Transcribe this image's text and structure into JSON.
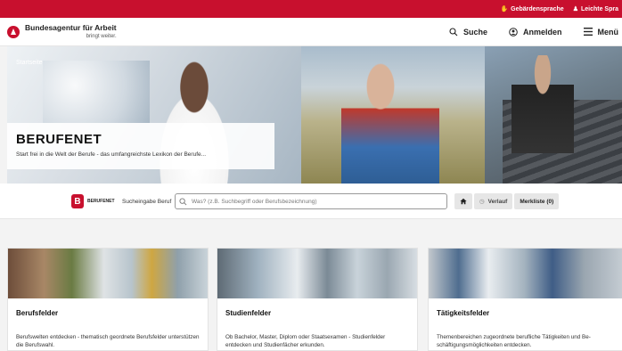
{
  "topbar": {
    "sign_language": "Gebärdensprache",
    "easy_language": "Leichte Spra",
    "color": "#c8102e"
  },
  "header": {
    "brand_title": "Bundesagentur für Arbeit",
    "brand_sub": "bringt weiter.",
    "search_label": "Suche",
    "login_label": "Anmelden",
    "menu_label": "Menü"
  },
  "hero": {
    "breadcrumb": "Startseite",
    "title": "BERUFENET",
    "subtitle": "Start frei in die Welt der Berufe - das umfangreichste Lexikon der Berufe..."
  },
  "searchbar": {
    "logo_letter": "B",
    "logo_text": "BERUFENET",
    "label": "Sucheingabe Beruf",
    "placeholder": "Was? (z.B. Suchbegriff oder Berufsbezeichnung)",
    "history_label": "Verlauf",
    "watchlist_label": "Merkliste (0)"
  },
  "cards": [
    {
      "title": "Berufsfelder",
      "description": "Berufswelten entdecken - thematisch geordnete Berufsfelder unterstützen die Berufswahl."
    },
    {
      "title": "Studienfelder",
      "description": "Ob Bachelor, Master, Diplom oder Staatsexamen - Studienfelder entdecken und Studienfächer erkunden."
    },
    {
      "title": "Tätigkeitsfelder",
      "description": "Themenbereichen zugeordnete berufliche Tätigkeiten und Be-schäftigungsmöglichkeiten entdecken."
    }
  ]
}
